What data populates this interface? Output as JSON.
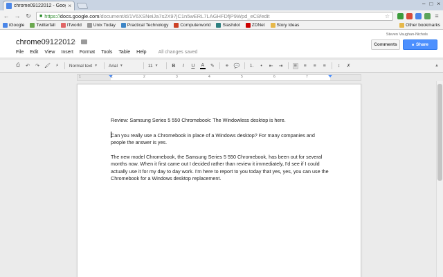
{
  "browser": {
    "tab_title": "chrome09122012 - Goog",
    "tab_close": "×",
    "url_scheme": "https://",
    "url_host": "docs.google.com",
    "url_path": "/document/d/1V6XSNeiJa7s2X97jC1n5wERL7LAGHFDfjP9Wpd_eC8/edit",
    "back_icon": "←",
    "forward_icon": "→",
    "reload_icon": "↻",
    "star_icon": "☆",
    "wrench_icon": "≡",
    "window_controls": {
      "minimize": "–",
      "maximize": "□",
      "close": "×"
    }
  },
  "bookmarks": [
    {
      "label": "iGoogle",
      "color": "#4a86e8"
    },
    {
      "label": "Twitterfall",
      "color": "#6aa84f"
    },
    {
      "label": "ITworld",
      "color": "#e06666"
    },
    {
      "label": "Unix Today",
      "color": "#999999"
    },
    {
      "label": "Practical Technology",
      "color": "#3d85c6"
    },
    {
      "label": "Computerworld",
      "color": "#cc4125"
    },
    {
      "label": "Slashdot",
      "color": "#2d8080"
    },
    {
      "label": "ZDNet",
      "color": "#cc0000"
    },
    {
      "label": "Story Ideas",
      "color": "#e6b84a"
    }
  ],
  "other_bookmarks": "Other bookmarks",
  "doc": {
    "title": "chrome09122012",
    "title_star": "☆",
    "menu": [
      "File",
      "Edit",
      "View",
      "Insert",
      "Format",
      "Tools",
      "Table",
      "Help"
    ],
    "save_status": "All changes saved",
    "user_name": "Steven Vaughan-Nichols",
    "comments_label": "Comments",
    "share_label": "Share",
    "share_icon": "🔒"
  },
  "format_toolbar": {
    "print_icon": "⎙",
    "undo_icon": "↶",
    "redo_icon": "↷",
    "paint_format_icon": "🖌",
    "zoom_icon": "⌕",
    "style_value": "Normal text",
    "font_value": "Arial",
    "size_value": "11",
    "bold_label": "B",
    "italic_label": "I",
    "underline_label": "U",
    "textcolor_label": "A",
    "highlight_icon": "✎",
    "link_icon": "⚭",
    "comment_icon": "💬",
    "numbered_list_icon": "⒈",
    "bullet_list_icon": "•",
    "indent_decrease_icon": "⇤",
    "indent_increase_icon": "⇥",
    "align_left_icon": "≡",
    "align_center_icon": "≡",
    "align_right_icon": "≡",
    "align_justify_icon": "≡",
    "line_spacing_icon": "↕",
    "clear_format_icon": "✗",
    "collapse_icon": "▲",
    "caret": "▼"
  },
  "ruler": {
    "numbers": [
      "1",
      "1",
      "2",
      "3",
      "4",
      "5",
      "6",
      "7"
    ]
  },
  "document_body": {
    "paragraphs": [
      "Review: Samsung Series 5 550 Chromebook: The Windowless desktop is here.",
      "Can you really use a Chromebook in place of a Windows desktop? For many companies and people the answer is yes.",
      "The new model Chromebook, the Samsung Series 5 550 Chromebook, has been out for several months now. When it first came out I decided rather than review it immediately, I'd see if I could actually use it for my day to day work. I'm here to report to you today that yes, yes, you can use the Chromebook for a Windows desktop replacement."
    ]
  },
  "colors": {
    "share_blue": "#4d90fe",
    "url_green": "#2a8a2a",
    "tabstrip": "#c9d4e3"
  }
}
